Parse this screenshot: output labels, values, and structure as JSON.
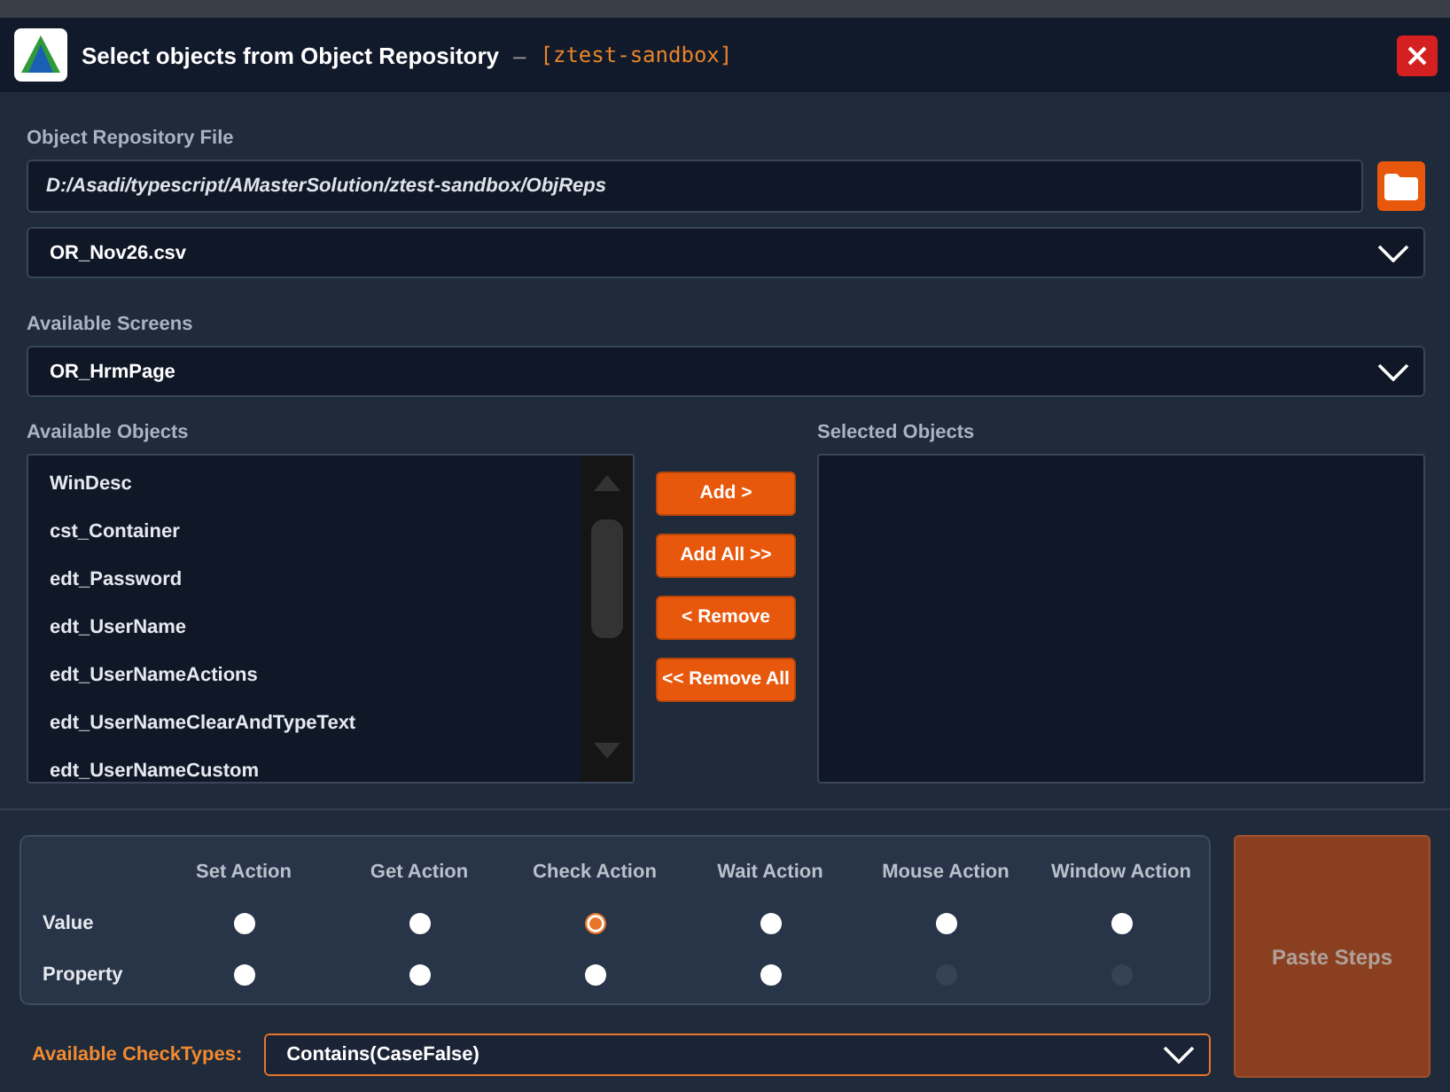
{
  "window": {
    "title": "Select objects from Object Repository",
    "separator": "–",
    "workspace": "[ztest-sandbox]"
  },
  "repository_file": {
    "label": "Object Repository File",
    "value": "D:/Asadi/typescript/AMasterSolution/ztest-sandbox/ObjReps"
  },
  "repository_dropdown": {
    "value": "OR_Nov26.csv"
  },
  "screens": {
    "label": "Available Screens",
    "value": "OR_HrmPage"
  },
  "available_objects": {
    "label": "Available Objects",
    "items": [
      "WinDesc",
      "cst_Container",
      "edt_Password",
      "edt_UserName",
      "edt_UserNameActions",
      "edt_UserNameClearAndTypeText",
      "edt_UserNameCustom"
    ]
  },
  "transfer_buttons": [
    "Add >",
    "Add All >>",
    "< Remove",
    "<< Remove All"
  ],
  "selected_objects": {
    "label": "Selected Objects"
  },
  "actions": {
    "columns": [
      "Set Action",
      "Get Action",
      "Check Action",
      "Wait Action",
      "Mouse Action",
      "Window Action"
    ],
    "rows": [
      {
        "label": "Value",
        "options": [
          {
            "selected": false,
            "disabled": false
          },
          {
            "selected": false,
            "disabled": false
          },
          {
            "selected": true,
            "disabled": false
          },
          {
            "selected": false,
            "disabled": false
          },
          {
            "selected": false,
            "disabled": false
          },
          {
            "selected": false,
            "disabled": false
          }
        ]
      },
      {
        "label": "Property",
        "options": [
          {
            "selected": false,
            "disabled": false
          },
          {
            "selected": false,
            "disabled": false
          },
          {
            "selected": false,
            "disabled": false
          },
          {
            "selected": false,
            "disabled": false
          },
          {
            "selected": false,
            "disabled": true
          },
          {
            "selected": false,
            "disabled": true
          }
        ]
      }
    ]
  },
  "paste_button": {
    "label": "Paste Steps",
    "disabled": true
  },
  "check_types": {
    "label": "Available CheckTypes:",
    "value": "Contains(CaseFalse)"
  }
}
